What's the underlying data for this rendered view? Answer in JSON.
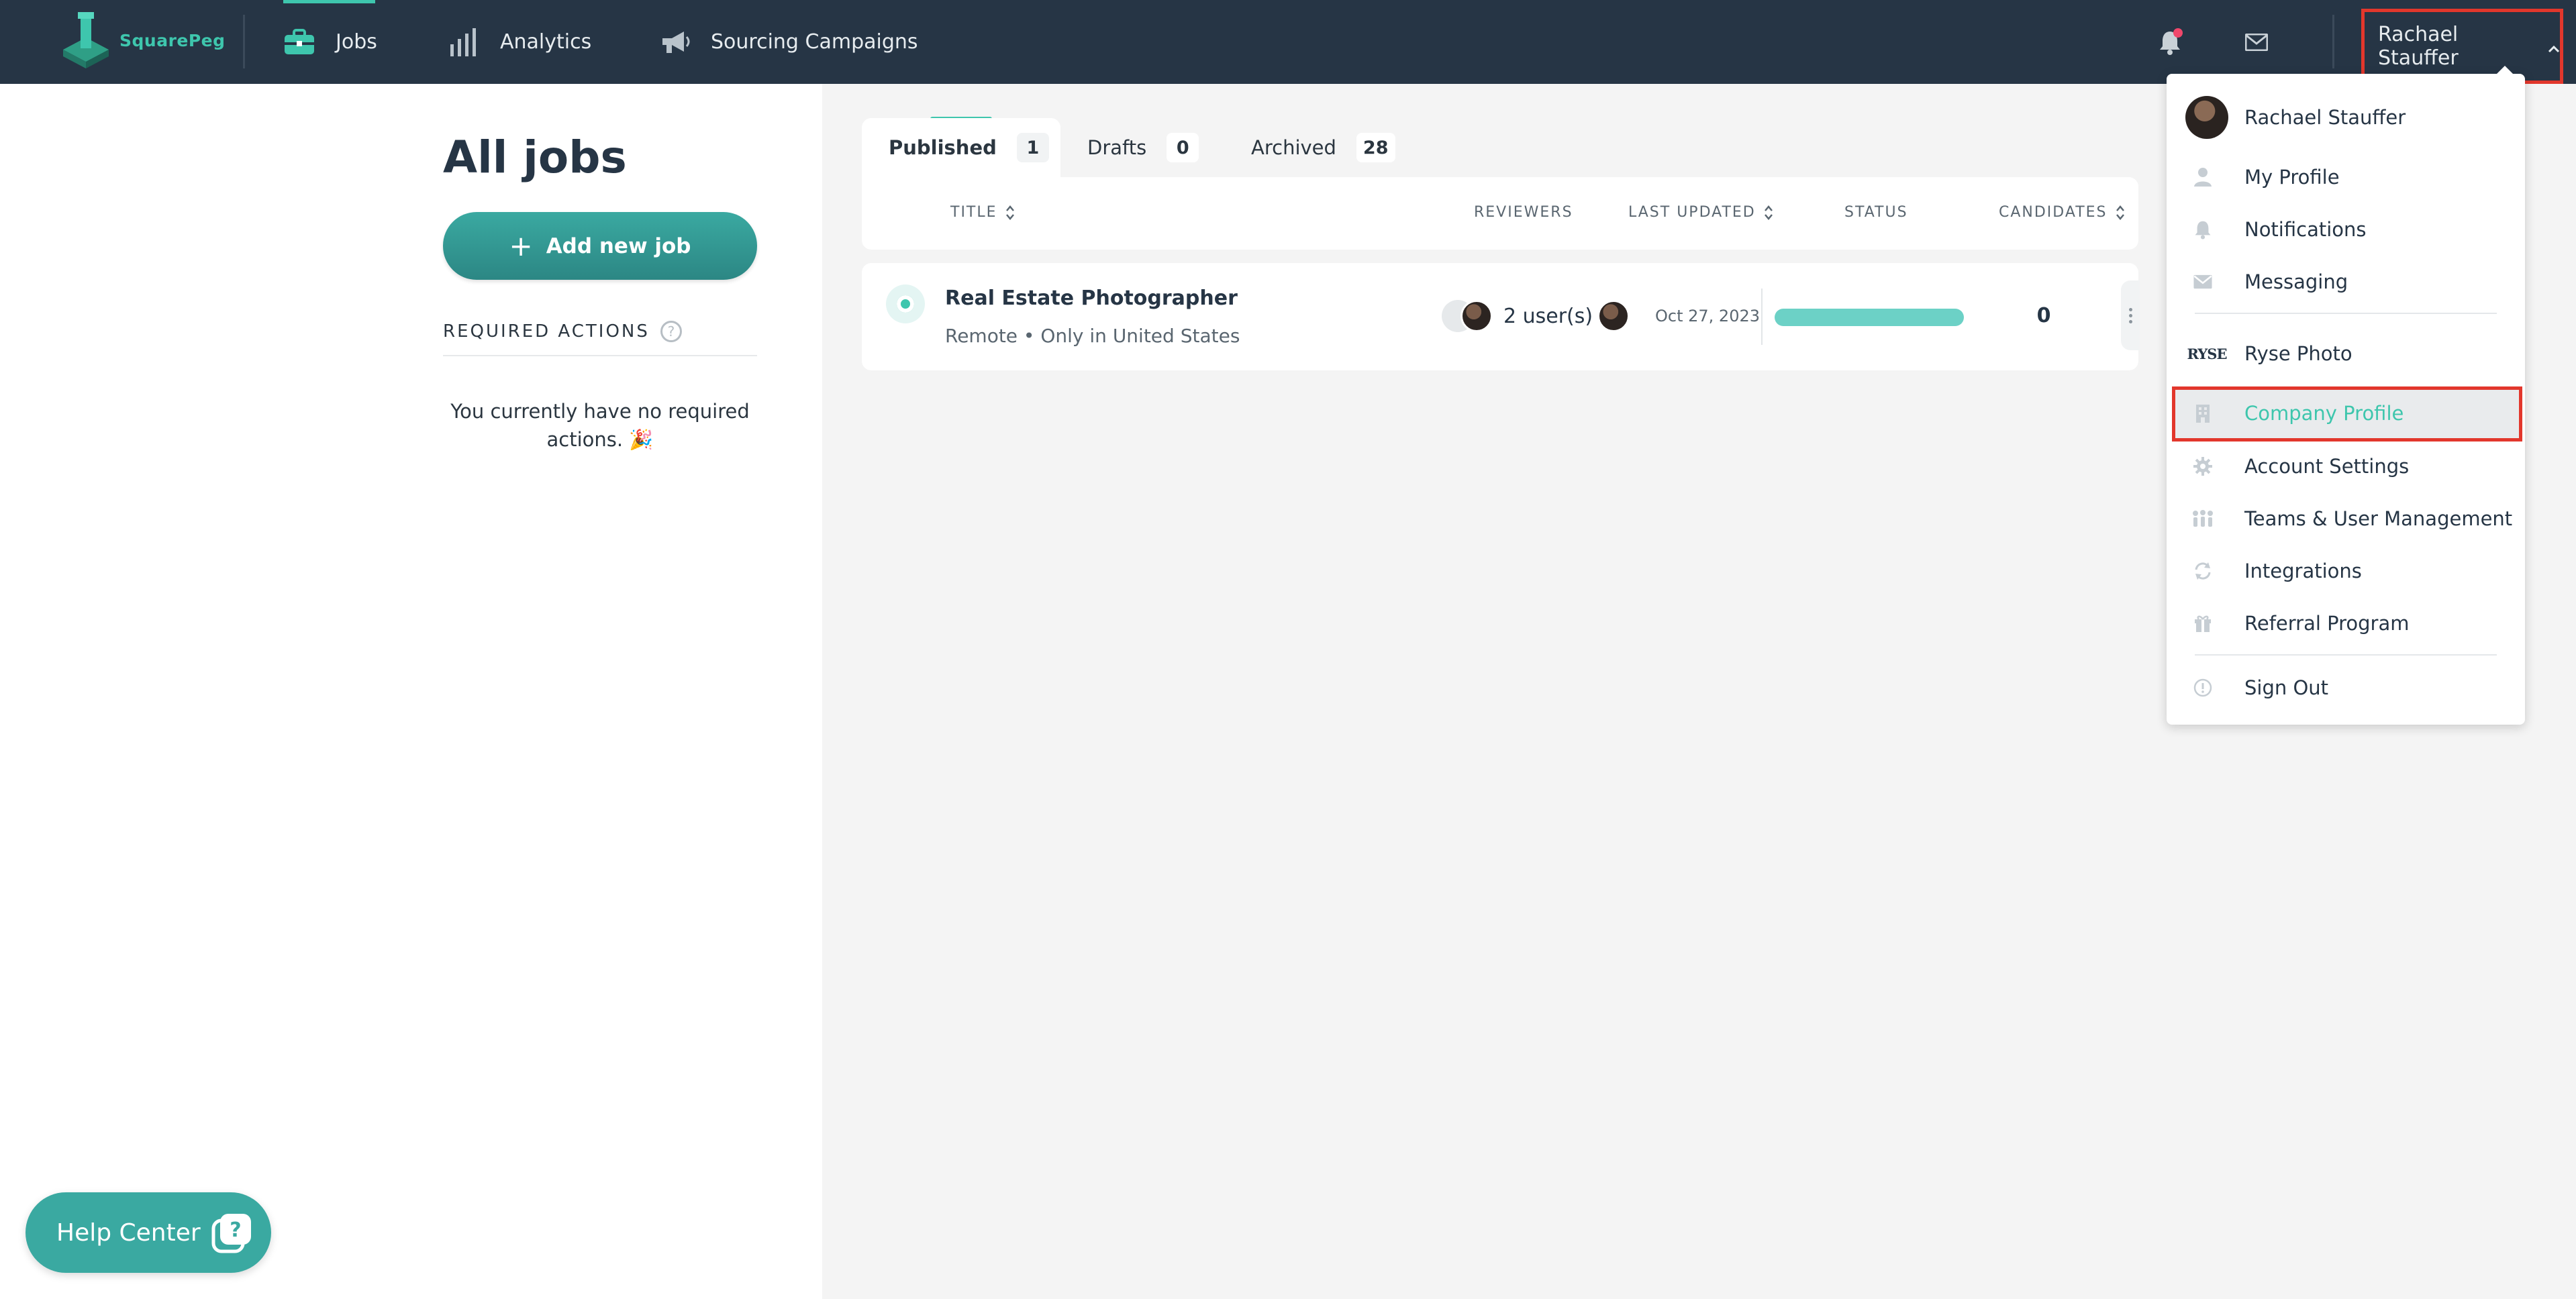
{
  "nav": {
    "logo_text": "SquarePeg",
    "items": [
      {
        "label": "Jobs",
        "icon": "briefcase-icon",
        "active": true
      },
      {
        "label": "Analytics",
        "icon": "bar-chart-icon"
      },
      {
        "label": "Sourcing Campaigns",
        "icon": "megaphone-icon"
      }
    ],
    "user_name": "Rachael Stauffer",
    "accent": "#3ec6ad",
    "bg": "#263545"
  },
  "sidebar": {
    "title": "All jobs",
    "add_button": "Add new job",
    "required_actions_label": "REQUIRED ACTIONS",
    "help_glyph": "?",
    "no_actions_text": "You currently have no required actions. 🎉",
    "help_center": "Help Center"
  },
  "tabs": [
    {
      "label": "Published",
      "count": "1"
    },
    {
      "label": "Drafts",
      "count": "0"
    },
    {
      "label": "Archived",
      "count": "28"
    }
  ],
  "table": {
    "headers": {
      "title": "TITLE",
      "reviewers": "REVIEWERS",
      "last_updated": "LAST UPDATED",
      "status": "STATUS",
      "candidates": "CANDIDATES"
    },
    "rows": [
      {
        "title": "Real Estate Photographer",
        "location": "Remote •  Only in United States",
        "reviewers": "2 user(s)",
        "last_updated": "Oct 27, 2023",
        "candidates": "0"
      }
    ]
  },
  "dropdown": {
    "user_name": "Rachael Stauffer",
    "company_logo_text": "RYSE",
    "items": [
      {
        "label": "My Profile",
        "icon": "person-icon"
      },
      {
        "label": "Notifications",
        "icon": "bell-icon"
      },
      {
        "label": "Messaging",
        "icon": "envelope-icon"
      },
      {
        "label": "Ryse Photo",
        "icon": "company-logo"
      },
      {
        "label": "Company Profile",
        "icon": "building-icon",
        "highlighted": true
      },
      {
        "label": "Account Settings",
        "icon": "gear-icon"
      },
      {
        "label": "Teams & User Management",
        "icon": "team-icon"
      },
      {
        "label": "Integrations",
        "icon": "sync-icon"
      },
      {
        "label": "Referral Program",
        "icon": "gift-icon"
      },
      {
        "label": "Sign Out",
        "icon": "info-circle-icon"
      }
    ]
  }
}
